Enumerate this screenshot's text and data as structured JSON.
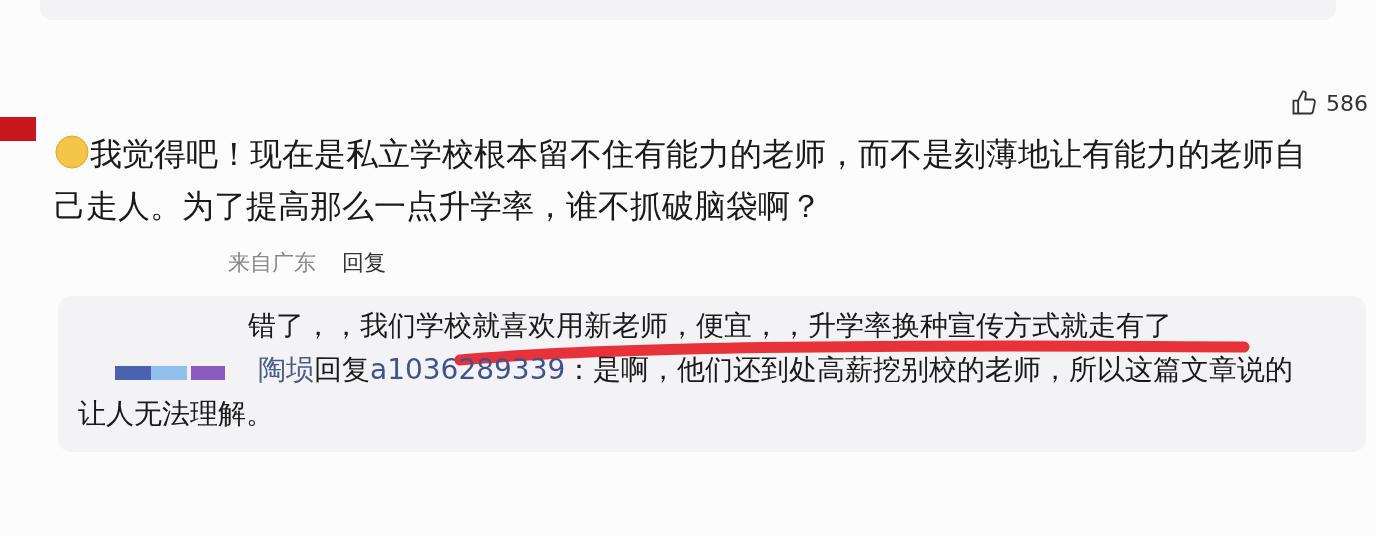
{
  "comment": {
    "likes": "586",
    "text": "我觉得吧！现在是私立学校根本留不住有能力的老师，而不是刻薄地让有能力的老师自己走人。为了提高那么一点升学率，谁不抓破脑袋啊？",
    "location": "来自广东",
    "reply_button": "回复"
  },
  "replies": [
    {
      "kind": "plain",
      "text": "错了，，我们学校就喜欢用新老师，便宜，，升学率换种宣传方式就走有了",
      "underlined": true
    },
    {
      "kind": "reply",
      "author": "陶埙",
      "reply_word": "回复",
      "target": "a1036289339",
      "text": "：是啊，他们还到处高薪挖别校的老师，所以这篇文章说的",
      "continuation": "让人无法理解。",
      "underlined": false
    }
  ]
}
